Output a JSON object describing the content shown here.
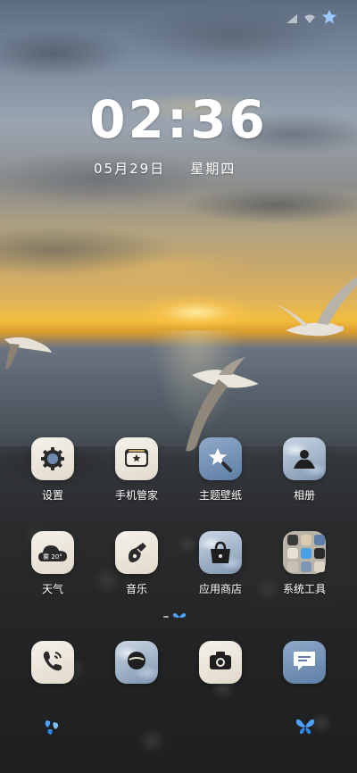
{
  "status_bar": {
    "icons": [
      "cellular-signal-icon",
      "wifi-icon",
      "star-icon"
    ]
  },
  "clock": {
    "time": "02:36",
    "date": "05月29日",
    "weekday": "星期四"
  },
  "apps_row1": [
    {
      "label": "设置",
      "icon": "settings-gear-icon"
    },
    {
      "label": "手机管家",
      "icon": "phone-manager-icon"
    },
    {
      "label": "主题壁纸",
      "icon": "theme-wallpaper-icon"
    },
    {
      "label": "相册",
      "icon": "gallery-icon"
    }
  ],
  "apps_row2": [
    {
      "label": "天气",
      "icon": "weather-icon",
      "badge": "雾 20°"
    },
    {
      "label": "音乐",
      "icon": "music-icon"
    },
    {
      "label": "应用商店",
      "icon": "app-store-icon"
    },
    {
      "label": "系统工具",
      "icon": "folder-icon"
    }
  ],
  "dock": [
    {
      "name": "phone",
      "icon": "phone-icon"
    },
    {
      "name": "browser",
      "icon": "browser-icon"
    },
    {
      "name": "camera",
      "icon": "camera-icon"
    },
    {
      "name": "messages",
      "icon": "messages-icon"
    }
  ],
  "page_indicator": {
    "current_page": 1
  },
  "colors": {
    "accent_blue": "#4da3ff",
    "label_white": "#ffffff"
  }
}
